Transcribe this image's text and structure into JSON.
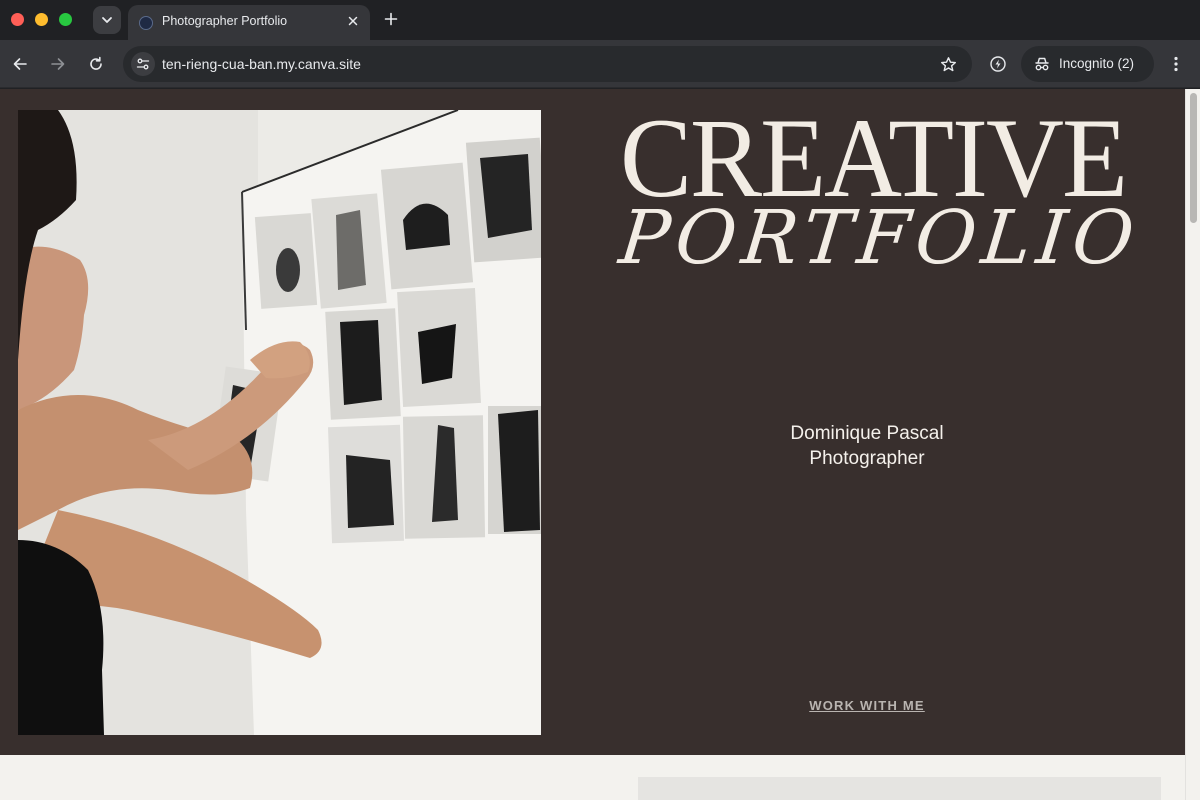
{
  "browser": {
    "tab": {
      "title": "Photographer Portfolio"
    },
    "url": "ten-rieng-cua-ban.my.canva.site",
    "incognito_label": "Incognito (2)"
  },
  "hero": {
    "title_line1": "CREATIVE",
    "title_line2": "PORTFOLIO",
    "name": "Dominique Pascal",
    "role": "Photographer",
    "cta": "WORK WITH ME"
  },
  "colors": {
    "hero_background": "#382f2d",
    "title_text": "#f2ece4",
    "cta_text": "#b9b4b0",
    "page_background": "#f3f2ee"
  },
  "icons": {
    "tab_search": "chevron-down-icon",
    "tab_close": "close-icon",
    "new_tab": "plus-icon",
    "back": "arrow-left-icon",
    "forward": "arrow-right-icon",
    "reload": "reload-icon",
    "site_settings": "tune-icon",
    "bookmark": "star-icon",
    "extension": "bolt-icon",
    "incognito": "incognito-icon",
    "menu": "kebab-menu-icon"
  }
}
